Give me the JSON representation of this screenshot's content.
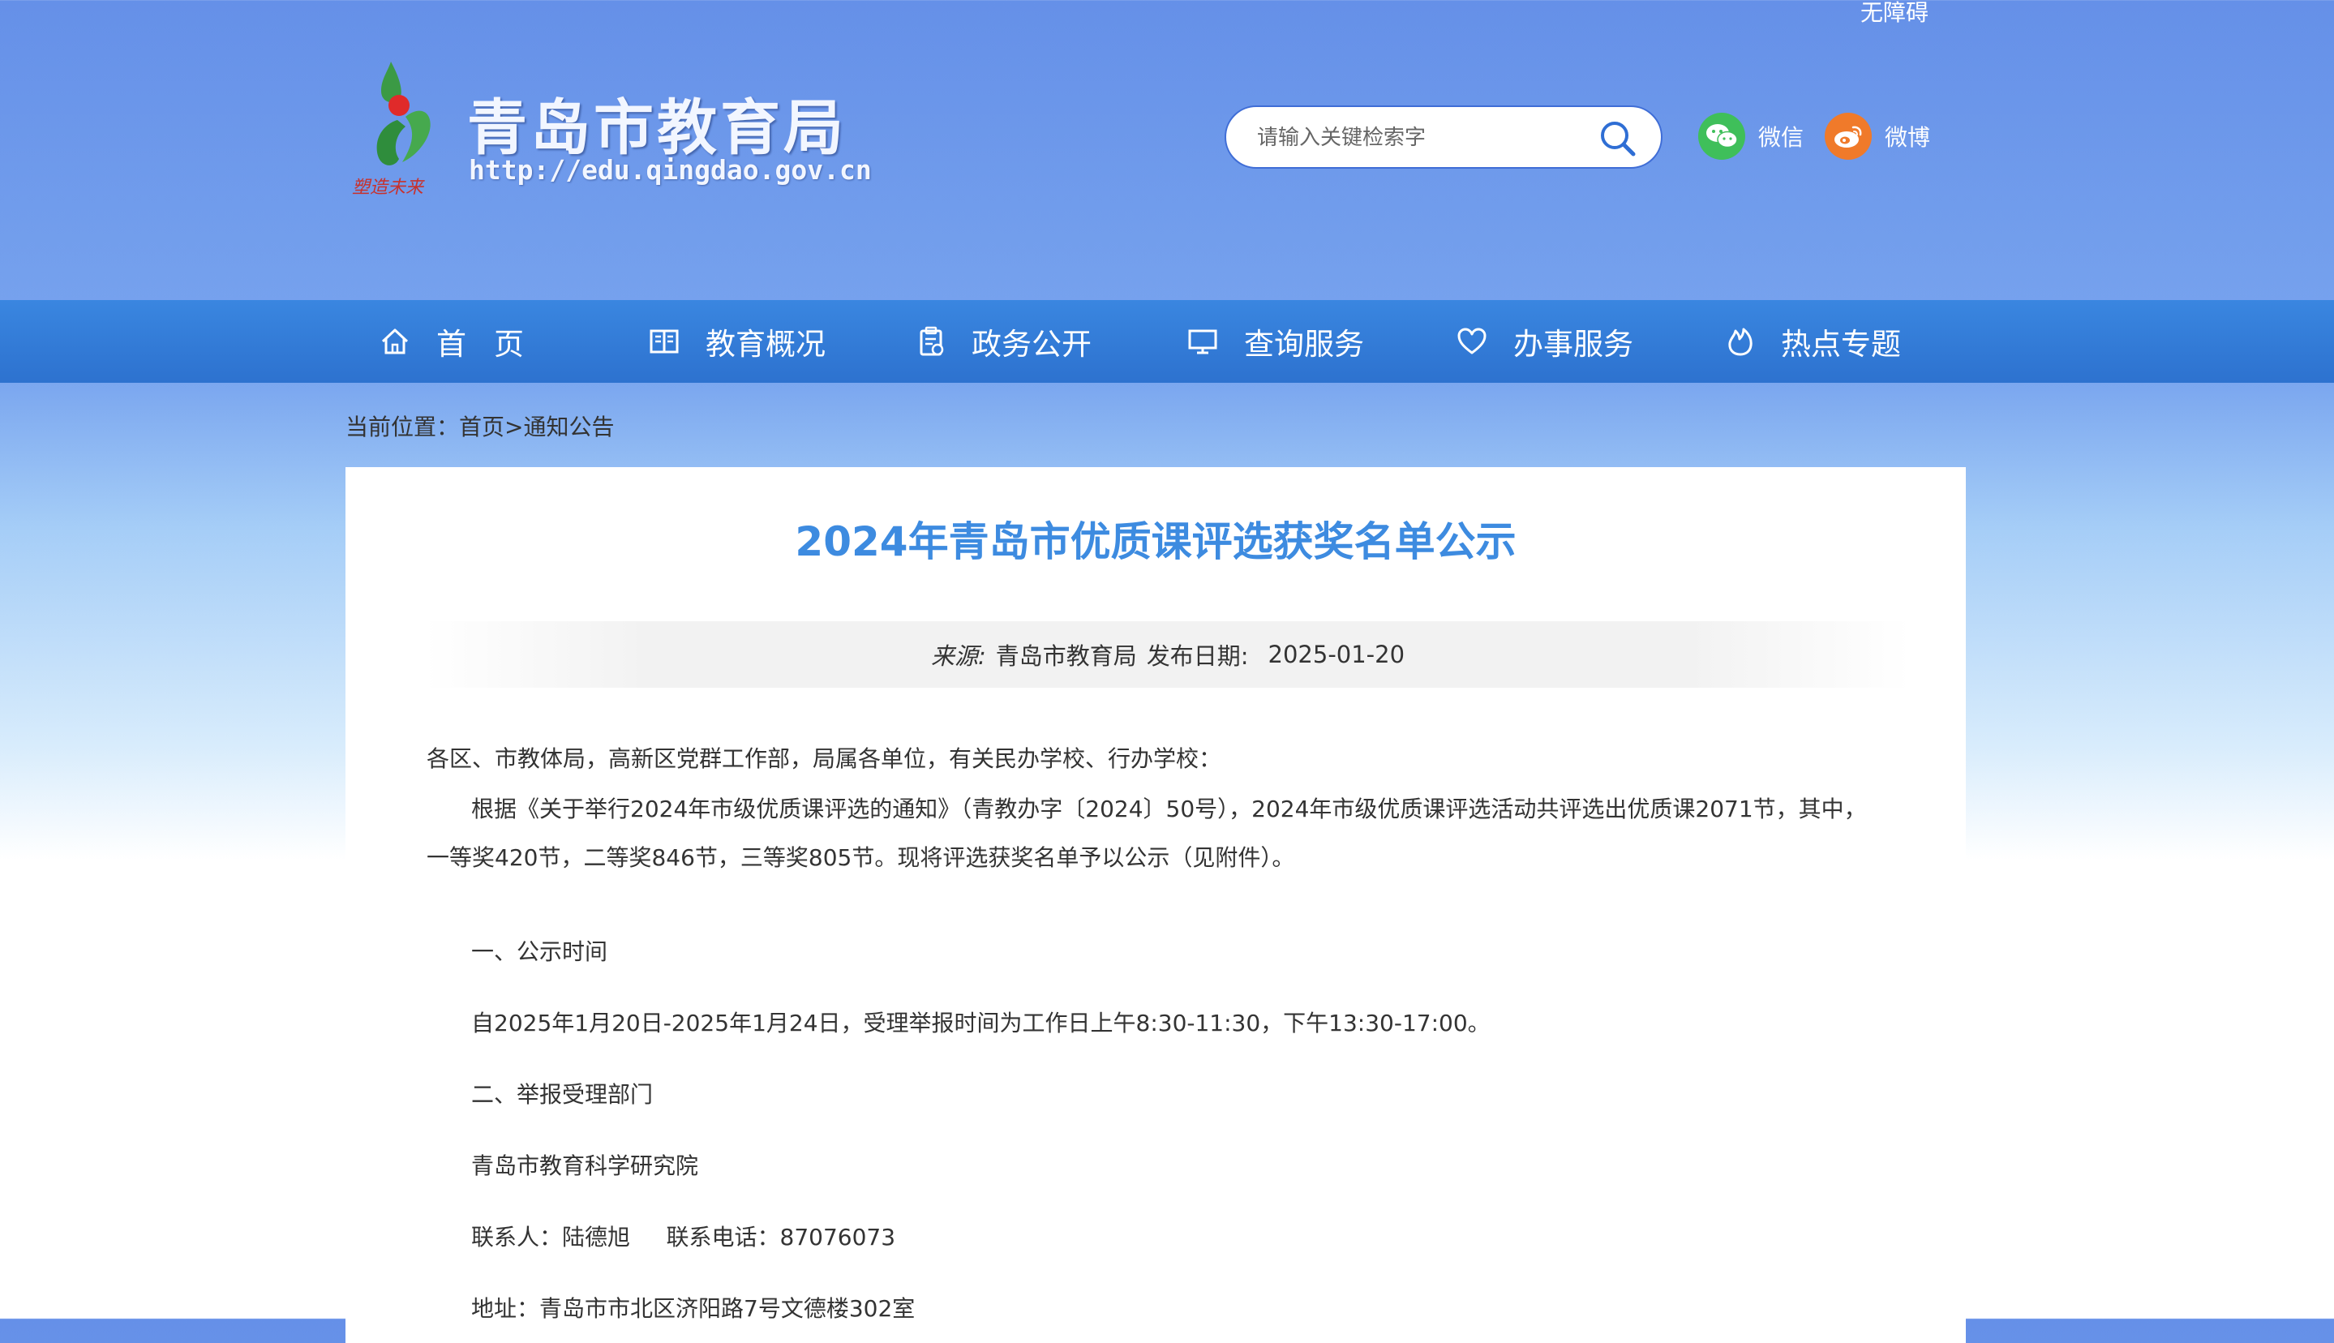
{
  "header": {
    "accessibility_link": "无障碍",
    "site_name": "青岛市教育局",
    "site_url": "http://edu.qingdao.gov.cn",
    "search": {
      "placeholder": "请输入关键检索字"
    },
    "social": [
      {
        "label": "微信",
        "icon": "wechat-icon",
        "color": "#3fbf5a"
      },
      {
        "label": "微博",
        "icon": "weibo-icon",
        "color": "#f07a2a"
      }
    ]
  },
  "nav": {
    "items": [
      {
        "label": "首页",
        "icon": "home-icon"
      },
      {
        "label": "教育概况",
        "icon": "book-icon"
      },
      {
        "label": "政务公开",
        "icon": "clipboard-icon"
      },
      {
        "label": "查询服务",
        "icon": "monitor-icon"
      },
      {
        "label": "办事服务",
        "icon": "heart-icon"
      },
      {
        "label": "热点专题",
        "icon": "flame-icon"
      }
    ]
  },
  "breadcrumb": {
    "prefix": "当前位置：",
    "home": "首页",
    "separator": ">",
    "current": "通知公告"
  },
  "article": {
    "title": "2024年青岛市优质课评选获奖名单公示",
    "source_label": "来源:",
    "source": "青岛市教育局",
    "date_label": "发布日期:",
    "date": "2025-01-20",
    "paragraphs": [
      "各区、市教体局，高新区党群工作部，局属各单位，有关民办学校、行办学校：",
      "根据《关于举行2024年市级优质课评选的通知》（青教办字〔2024〕50号），2024年市级优质课评选活动共评选出优质课2071节，其中，一等奖420节，二等奖846节，三等奖805节。现将评选获奖名单予以公示（见附件）。",
      "一、公示时间",
      "自2025年1月20日-2025年1月24日，受理举报时间为工作日上午8:30-11:30，下午13:30-17:00。",
      "二、举报受理部门",
      "青岛市教育科学研究院",
      "联系人：陆德旭     联系电话：87076073",
      "地址：青岛市市北区济阳路7号文德楼302室"
    ]
  },
  "colors": {
    "nav_bg": "#2f78d6",
    "title": "#3d8be0",
    "header_bg": "#6590e8"
  }
}
